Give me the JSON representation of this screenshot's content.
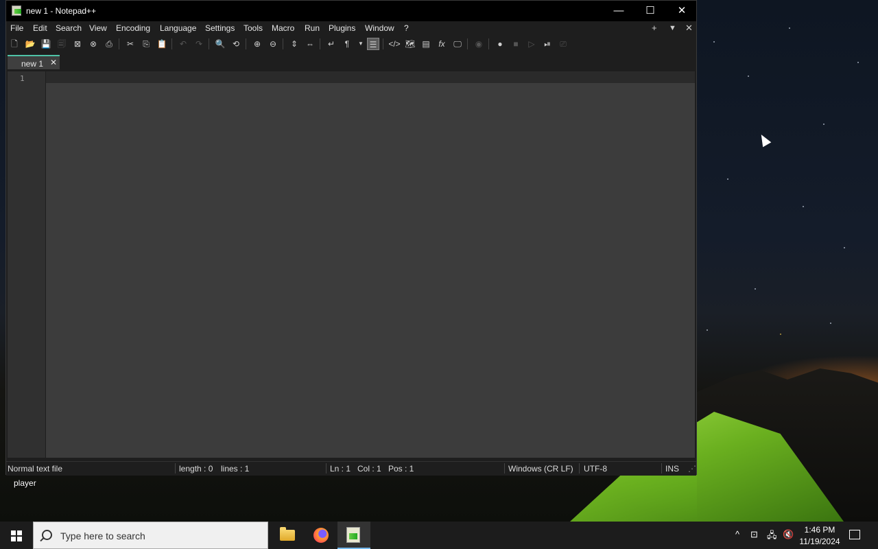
{
  "window": {
    "title": "new 1 - Notepad++",
    "controls": {
      "minimize": "—",
      "maximize": "☐",
      "close": "✕"
    }
  },
  "menu": {
    "items": [
      "File",
      "Edit",
      "Search",
      "View",
      "Encoding",
      "Language",
      "Settings",
      "Tools",
      "Macro",
      "Run",
      "Plugins",
      "Window",
      "?"
    ],
    "right": {
      "add": "+",
      "list": "▼",
      "close": "✕"
    }
  },
  "toolbar": {
    "icons": [
      "new-file",
      "open-file",
      "save",
      "save-all",
      "close",
      "close-all",
      "print",
      "cut",
      "copy",
      "paste",
      "undo",
      "redo",
      "find",
      "replace",
      "zoom-in",
      "zoom-out",
      "sync-vertical",
      "sync-horizontal",
      "word-wrap",
      "show-all-characters",
      "indent-guide",
      "user-defined-language",
      "document-map",
      "function-list",
      "folder-as-workspace",
      "monitoring",
      "start-recording",
      "stop-recording",
      "playback",
      "save-macro",
      "run-macro-multiple"
    ]
  },
  "tabs": [
    {
      "label": "new 1",
      "close": "✕",
      "active": true
    }
  ],
  "editor": {
    "lines": [
      "1"
    ],
    "content": ""
  },
  "status": {
    "file_type": "Normal text file",
    "length": "length : 0",
    "lines": "lines : 1",
    "ln": "Ln : 1",
    "col": "Col : 1",
    "pos": "Pos : 1",
    "eol": "Windows (CR LF)",
    "encoding": "UTF-8",
    "mode": "INS"
  },
  "desktop": {
    "icon_label": "player"
  },
  "taskbar": {
    "search_placeholder": "Type here to search",
    "apps": [
      "file-explorer",
      "firefox",
      "notepad-plus-plus"
    ],
    "tray": {
      "chevron": "^",
      "time": "1:46 PM",
      "date": "11/19/2024"
    }
  },
  "colors": {
    "accent_tab": "#4fc3a8",
    "editor_bg": "#3c3c3c",
    "titlebar_bg": "#000000",
    "taskbar_bg": "#1c1c1c"
  }
}
